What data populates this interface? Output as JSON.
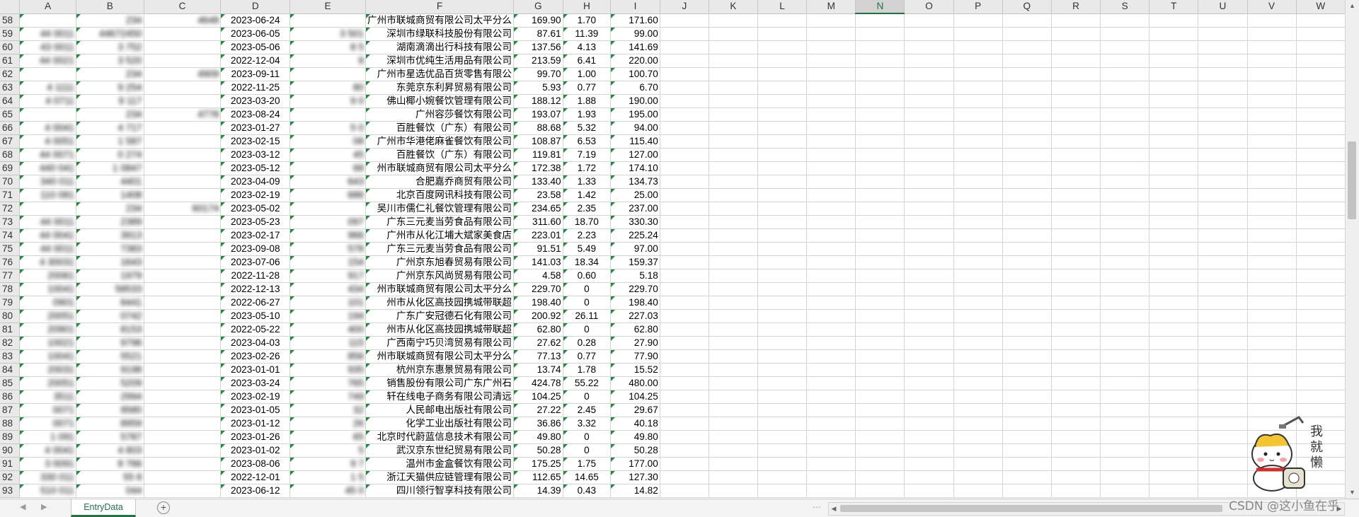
{
  "columns": [
    "A",
    "B",
    "C",
    "D",
    "E",
    "F",
    "G",
    "H",
    "I",
    "J",
    "K",
    "L",
    "M",
    "N",
    "O",
    "P",
    "Q",
    "R",
    "S",
    "T",
    "U",
    "V",
    "W"
  ],
  "active_column": "N",
  "rows": [
    {
      "n": "58",
      "a": "",
      "b": "234",
      "c": "4648",
      "d": "2023-06-24",
      "e": "",
      "f": "广州市联城商贸有限公司太平分么",
      "g": "169.90",
      "h": "1.70",
      "i": "171.60"
    },
    {
      "n": "59",
      "a": "44 0011",
      "b": "44672450",
      "c": "",
      "d": "2023-06-05",
      "e": "3 501",
      "f": "深圳市绿联科技股份有限公司",
      "g": "87.61",
      "h": "11.39",
      "i": "99.00"
    },
    {
      "n": "60",
      "a": "43 0011",
      "b": "3 752",
      "c": "",
      "d": "2023-05-06",
      "e": "8 5",
      "f": "湖南滴滴出行科技有限公司",
      "g": "137.56",
      "h": "4.13",
      "i": "141.69"
    },
    {
      "n": "61",
      "a": "44 0021",
      "b": "3 520",
      "c": "",
      "d": "2022-12-04",
      "e": "8",
      "f": "深圳市优纯生活用品有限公司",
      "g": "213.59",
      "h": "6.41",
      "i": "220.00"
    },
    {
      "n": "62",
      "a": "",
      "b": "234",
      "c": "4909",
      "d": "2023-09-11",
      "e": "",
      "f": "广州市星选优品百货零售有限公",
      "g": "99.70",
      "h": "1.00",
      "i": "100.70"
    },
    {
      "n": "63",
      "a": "4 1111",
      "b": "9 254",
      "c": "",
      "d": "2022-11-25",
      "e": "80",
      "f": "东莞京东利昇贸易有限公司",
      "g": "5.93",
      "h": "0.77",
      "i": "6.70"
    },
    {
      "n": "64",
      "a": "4 0711",
      "b": "9 117",
      "c": "",
      "d": "2023-03-20",
      "e": "9 0",
      "f": "佛山椰小婉餐饮管理有限公司",
      "g": "188.12",
      "h": "1.88",
      "i": "190.00"
    },
    {
      "n": "65",
      "a": "",
      "b": "234",
      "c": "4778",
      "d": "2023-08-24",
      "e": "",
      "f": "广州容莎餐饮有限公司",
      "g": "193.07",
      "h": "1.93",
      "i": "195.00"
    },
    {
      "n": "66",
      "a": "4 0041",
      "b": "4 717",
      "c": "",
      "d": "2023-01-27",
      "e": "5 0",
      "f": "百胜餐饮（广东）有限公司",
      "g": "88.68",
      "h": "5.32",
      "i": "94.00"
    },
    {
      "n": "67",
      "a": "4 0051",
      "b": "1 587",
      "c": "",
      "d": "2023-02-15",
      "e": "08",
      "f": "广州市华港佬麻雀餐饮有限公司",
      "g": "108.87",
      "h": "6.53",
      "i": "115.40"
    },
    {
      "n": "68",
      "a": "44 0071",
      "b": "0 274",
      "c": "",
      "d": "2023-03-12",
      "e": "45",
      "f": "百胜餐饮（广东）有限公司",
      "g": "119.81",
      "h": "7.19",
      "i": "127.00"
    },
    {
      "n": "69",
      "a": "440 041",
      "b": "1 0847",
      "c": "",
      "d": "2023-05-12",
      "e": "68",
      "f": "州市联城商贸有限公司太平分么",
      "g": "172.38",
      "h": "1.72",
      "i": "174.10"
    },
    {
      "n": "70",
      "a": "340 011",
      "b": "4401",
      "c": "",
      "d": "2023-04-09",
      "e": "643",
      "f": "合肥嘉乔商贸有限公司",
      "g": "133.40",
      "h": "1.33",
      "i": "134.73"
    },
    {
      "n": "71",
      "a": "110 081",
      "b": "1408",
      "c": "",
      "d": "2023-02-19",
      "e": "686",
      "f": "北京百度网讯科技有限公司",
      "g": "23.58",
      "h": "1.42",
      "i": "25.00"
    },
    {
      "n": "72",
      "a": "",
      "b": "234",
      "c": "60174",
      "d": "2023-05-02",
      "e": "",
      "f": "吴川市儒仁礼餐饮管理有限公司",
      "g": "234.65",
      "h": "2.35",
      "i": "237.00"
    },
    {
      "n": "73",
      "a": "44 0011",
      "b": "2389",
      "c": "",
      "d": "2023-05-23",
      "e": "097",
      "f": "广东三元麦当劳食品有限公司",
      "g": "311.60",
      "h": "18.70",
      "i": "330.30"
    },
    {
      "n": "74",
      "a": "44 0041",
      "b": "3913",
      "c": "",
      "d": "2023-02-17",
      "e": "966",
      "f": "广州市从化江埔大斌家美食店",
      "g": "223.01",
      "h": "2.23",
      "i": "225.24"
    },
    {
      "n": "75",
      "a": "44 0011",
      "b": "7383",
      "c": "",
      "d": "2023-09-08",
      "e": "578",
      "f": "广东三元麦当劳食品有限公司",
      "g": "91.51",
      "h": "5.49",
      "i": "97.00"
    },
    {
      "n": "76",
      "a": "4 30031",
      "b": "1643",
      "c": "",
      "d": "2023-07-06",
      "e": "154",
      "f": "广州京东旭春贸易有限公司",
      "g": "141.03",
      "h": "18.34",
      "i": "159.37"
    },
    {
      "n": "77",
      "a": "20061",
      "b": "1979",
      "c": "",
      "d": "2022-11-28",
      "e": "917",
      "f": "广州京东风尚贸易有限公司",
      "g": "4.58",
      "h": "0.60",
      "i": "5.18"
    },
    {
      "n": "78",
      "a": "10041",
      "b": "58533",
      "c": "",
      "d": "2022-12-13",
      "e": "434",
      "f": "州市联城商贸有限公司太平分么",
      "g": "229.70",
      "h": "0",
      "i": "229.70"
    },
    {
      "n": "79",
      "a": "0901",
      "b": "6441",
      "c": "",
      "d": "2022-06-27",
      "e": "101",
      "f": "州市从化区高技园携城带联超",
      "g": "198.40",
      "h": "0",
      "i": "198.40"
    },
    {
      "n": "80",
      "a": "20051",
      "b": "0742",
      "c": "",
      "d": "2023-05-10",
      "e": "194",
      "f": "广东广安冠德石化有限公司",
      "g": "200.92",
      "h": "26.11",
      "i": "227.03"
    },
    {
      "n": "81",
      "a": "20901",
      "b": "8153",
      "c": "",
      "d": "2022-05-22",
      "e": "400",
      "f": "州市从化区高技园携城带联超",
      "g": "62.80",
      "h": "0",
      "i": "62.80"
    },
    {
      "n": "82",
      "a": "10021",
      "b": "9796",
      "c": "",
      "d": "2023-04-03",
      "e": "115",
      "f": "广西南宁巧贝湾贸易有限公司",
      "g": "27.62",
      "h": "0.28",
      "i": "27.90"
    },
    {
      "n": "83",
      "a": "10041",
      "b": "5521",
      "c": "",
      "d": "2023-02-26",
      "e": "856",
      "f": "州市联城商贸有限公司太平分么",
      "g": "77.13",
      "h": "0.77",
      "i": "77.90"
    },
    {
      "n": "84",
      "a": "20031",
      "b": "9198",
      "c": "",
      "d": "2023-01-01",
      "e": "935",
      "f": "杭州京东惠景贸易有限公司",
      "g": "13.74",
      "h": "1.78",
      "i": "15.52"
    },
    {
      "n": "85",
      "a": "20051",
      "b": "5209",
      "c": "",
      "d": "2023-03-24",
      "e": "765",
      "f": "销售股份有限公司广东广州石",
      "g": "424.78",
      "h": "55.22",
      "i": "480.00"
    },
    {
      "n": "86",
      "a": "3511",
      "b": "2994",
      "c": "",
      "d": "2023-02-19",
      "e": "749",
      "f": "轩在线电子商务有限公司清远",
      "g": "104.25",
      "h": "0",
      "i": "104.25"
    },
    {
      "n": "87",
      "a": "0071",
      "b": "9580",
      "c": "",
      "d": "2023-01-05",
      "e": "32",
      "f": "人民邮电出版社有限公司",
      "g": "27.22",
      "h": "2.45",
      "i": "29.67"
    },
    {
      "n": "88",
      "a": "0071",
      "b": "8959",
      "c": "",
      "d": "2023-01-12",
      "e": "26",
      "f": "化学工业出版社有限公司",
      "g": "36.86",
      "h": "3.32",
      "i": "40.18"
    },
    {
      "n": "89",
      "a": "1 091",
      "b": "5787",
      "c": "",
      "d": "2023-01-26",
      "e": "65",
      "f": "北京时代蔚蓝信息技术有限公司",
      "g": "49.80",
      "h": "0",
      "i": "49.80"
    },
    {
      "n": "90",
      "a": "4 0041",
      "b": "4 803",
      "c": "",
      "d": "2023-01-02",
      "e": "5",
      "f": "武汉京东世纪贸易有限公司",
      "g": "50.28",
      "h": "0",
      "i": "50.28"
    },
    {
      "n": "91",
      "a": "3 0091",
      "b": "8 766",
      "c": "",
      "d": "2023-08-06",
      "e": "9 7",
      "f": "温州市金盒餐饮有限公司",
      "g": "175.25",
      "h": "1.75",
      "i": "177.00"
    },
    {
      "n": "92",
      "a": "330 011",
      "b": "55 8",
      "c": "",
      "d": "2022-12-01",
      "e": "1 5",
      "f": "浙江天猫供应链管理有限公司",
      "g": "112.65",
      "h": "14.65",
      "i": "127.30"
    },
    {
      "n": "93",
      "a": "510 011",
      "b": "044",
      "c": "",
      "d": "2023-06-12",
      "e": "45 0",
      "f": "四川领行智享科技有限公司",
      "g": "14.39",
      "h": "0.43",
      "i": "14.82"
    }
  ],
  "tabs": {
    "sheet": "EntryData",
    "add_symbol": "+"
  },
  "scroll": {
    "more": "⋯",
    "left": "◀",
    "right": "▶",
    "up": "▲",
    "down": "▼"
  },
  "nav": {
    "prev": "◀",
    "next": "▶"
  },
  "watermark": "CSDN @这小鱼在乎",
  "sticker_text": "我就懒"
}
